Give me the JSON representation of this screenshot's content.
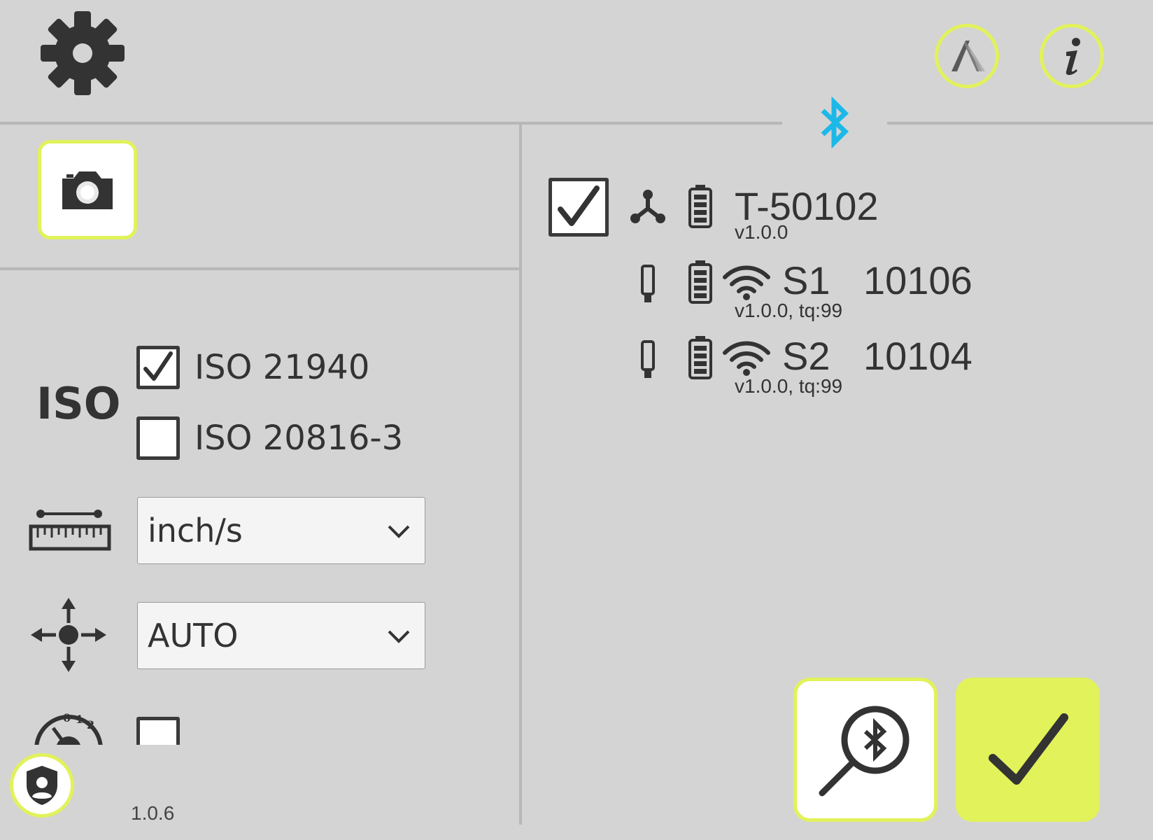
{
  "header": {
    "settings_icon": "gear-icon",
    "brand_icon": "brand-a-icon",
    "info_icon": "info-icon",
    "bluetooth_icon": "bluetooth-icon"
  },
  "left": {
    "camera_icon": "camera-icon",
    "iso_label": "ISO",
    "iso_options": [
      {
        "label": "ISO 21940",
        "checked": true
      },
      {
        "label": "ISO 20816-3",
        "checked": false
      }
    ],
    "unit_select": {
      "value": "inch/s",
      "icon": "ruler-icon"
    },
    "mode_select": {
      "value": "AUTO",
      "icon": "direction-arrows-icon"
    },
    "gauge_icon": "gauge-icon",
    "gauge_ticks": [
      "0",
      "1",
      "2"
    ],
    "gauge_checked": false,
    "version": "1.0.6",
    "security_icon": "shield-user-icon"
  },
  "right": {
    "transmitter": {
      "name": "T-50102",
      "version": "v1.0.0",
      "checked": true
    },
    "sensors": [
      {
        "name": "S1",
        "id": "10106",
        "version": "v1.0.0, tq:99"
      },
      {
        "name": "S2",
        "id": "10104",
        "version": "v1.0.0, tq:99"
      }
    ],
    "scan_button_icon": "bluetooth-search-icon",
    "confirm_button_icon": "checkmark-icon"
  },
  "colors": {
    "accent": "#e1f25a",
    "bluetooth": "#1cb8e8",
    "background": "#d4d4d4",
    "icon": "#333333"
  }
}
